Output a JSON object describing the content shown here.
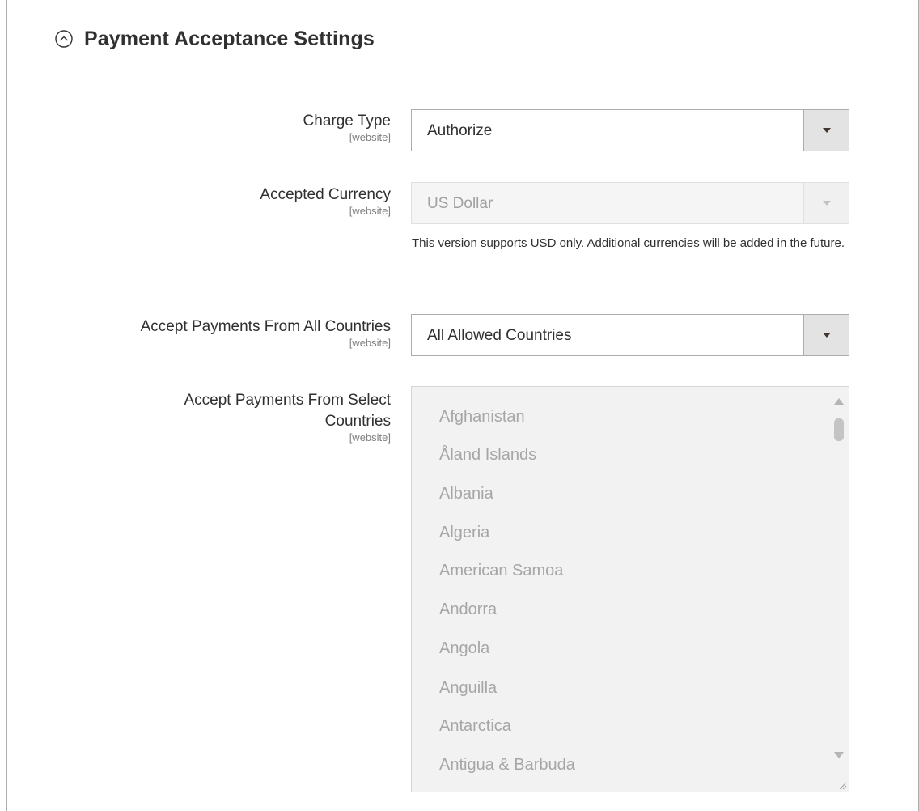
{
  "section": {
    "title": "Payment Acceptance Settings",
    "collapse_icon": "chevron-up-circle-icon"
  },
  "fields": {
    "charge_type": {
      "label": "Charge Type",
      "scope": "[website]",
      "value": "Authorize"
    },
    "accepted_currency": {
      "label": "Accepted Currency",
      "scope": "[website]",
      "value": "US Dollar",
      "note": "This version supports USD only. Additional currencies will be added in the future."
    },
    "accept_all_countries": {
      "label": "Accept Payments From All Countries",
      "scope": "[website]",
      "value": "All Allowed Countries"
    },
    "select_countries": {
      "label_line1": "Accept Payments From Select",
      "label_line2": "Countries",
      "scope": "[website]",
      "options": [
        "Afghanistan",
        "Åland Islands",
        "Albania",
        "Algeria",
        "American Samoa",
        "Andorra",
        "Angola",
        "Anguilla",
        "Antarctica",
        "Antigua & Barbuda"
      ]
    }
  },
  "colors": {
    "text": "#303030",
    "scope_text": "#808080",
    "disabled_text": "#a6a6a6",
    "arrow_box": "#e3e3e3",
    "border": "#adadad"
  }
}
